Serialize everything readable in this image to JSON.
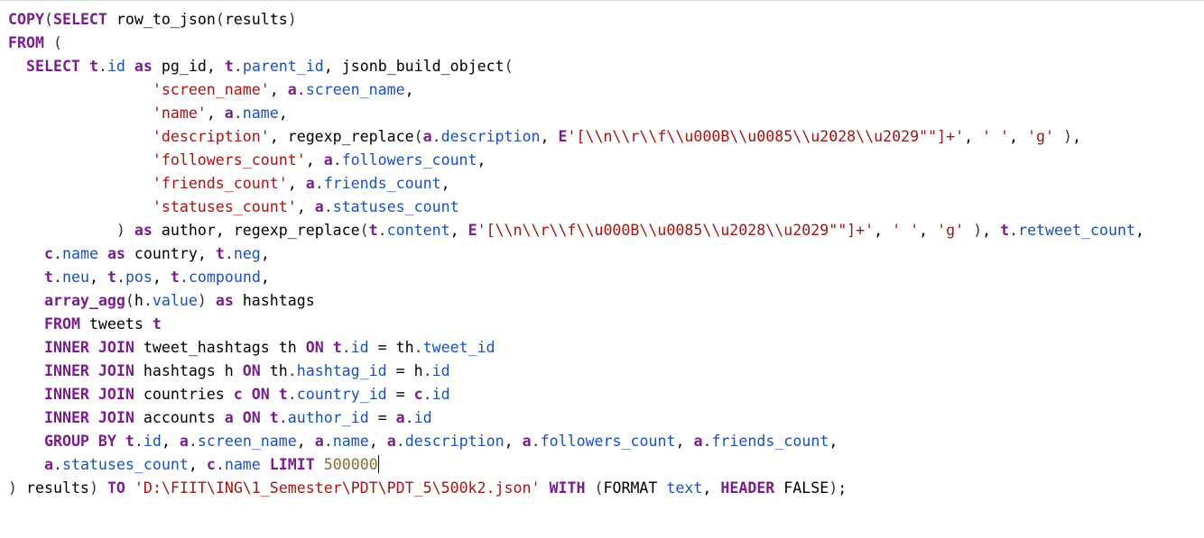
{
  "editor": {
    "lines": [
      [
        [
          "keyword",
          "COPY"
        ],
        [
          "punct",
          "("
        ],
        [
          "keyword",
          "SELECT"
        ],
        [
          "plain",
          " row_to_json"
        ],
        [
          "punct",
          "("
        ],
        [
          "plain",
          "results"
        ],
        [
          "punct",
          ")"
        ]
      ],
      [
        [
          "keyword",
          "FROM"
        ],
        [
          "plain",
          " "
        ],
        [
          "punct",
          "("
        ]
      ],
      [
        [
          "plain",
          "  "
        ],
        [
          "keyword",
          "SELECT"
        ],
        [
          "plain",
          " "
        ],
        [
          "alias",
          "t"
        ],
        [
          "punct",
          "."
        ],
        [
          "member",
          "id"
        ],
        [
          "plain",
          " "
        ],
        [
          "keyword",
          "as"
        ],
        [
          "plain",
          " pg_id, "
        ],
        [
          "alias",
          "t"
        ],
        [
          "punct",
          "."
        ],
        [
          "member",
          "parent_id"
        ],
        [
          "plain",
          ", jsonb_build_object"
        ],
        [
          "punct",
          "("
        ]
      ],
      [
        [
          "plain",
          "                "
        ],
        [
          "string",
          "'screen_name'"
        ],
        [
          "plain",
          ", "
        ],
        [
          "alias",
          "a"
        ],
        [
          "punct",
          "."
        ],
        [
          "member",
          "screen_name"
        ],
        [
          "plain",
          ","
        ]
      ],
      [
        [
          "plain",
          "                "
        ],
        [
          "string",
          "'name'"
        ],
        [
          "plain",
          ", "
        ],
        [
          "alias",
          "a"
        ],
        [
          "punct",
          "."
        ],
        [
          "member",
          "name"
        ],
        [
          "plain",
          ","
        ]
      ],
      [
        [
          "plain",
          "                "
        ],
        [
          "string",
          "'description'"
        ],
        [
          "plain",
          ", regexp_replace"
        ],
        [
          "punct",
          "("
        ],
        [
          "alias",
          "a"
        ],
        [
          "punct",
          "."
        ],
        [
          "member",
          "description"
        ],
        [
          "plain",
          ", "
        ],
        [
          "keyword",
          "E"
        ],
        [
          "string",
          "'[\\\\n\\\\r\\\\f\\\\u000B\\\\u0085\\\\u2028\\\\u2029\"\"]+'"
        ],
        [
          "plain",
          ", "
        ],
        [
          "string",
          "' '"
        ],
        [
          "plain",
          ", "
        ],
        [
          "string",
          "'g'"
        ],
        [
          "plain",
          " "
        ],
        [
          "punct",
          ")"
        ],
        [
          "plain",
          ","
        ]
      ],
      [
        [
          "plain",
          "                "
        ],
        [
          "string",
          "'followers_count'"
        ],
        [
          "plain",
          ", "
        ],
        [
          "alias",
          "a"
        ],
        [
          "punct",
          "."
        ],
        [
          "member",
          "followers_count"
        ],
        [
          "plain",
          ","
        ]
      ],
      [
        [
          "plain",
          "                "
        ],
        [
          "string",
          "'friends_count'"
        ],
        [
          "plain",
          ", "
        ],
        [
          "alias",
          "a"
        ],
        [
          "punct",
          "."
        ],
        [
          "member",
          "friends_count"
        ],
        [
          "plain",
          ","
        ]
      ],
      [
        [
          "plain",
          "                "
        ],
        [
          "string",
          "'statuses_count'"
        ],
        [
          "plain",
          ", "
        ],
        [
          "alias",
          "a"
        ],
        [
          "punct",
          "."
        ],
        [
          "member",
          "statuses_count"
        ]
      ],
      [
        [
          "plain",
          "            "
        ],
        [
          "punct",
          ")"
        ],
        [
          "plain",
          " "
        ],
        [
          "keyword",
          "as"
        ],
        [
          "plain",
          " author, regexp_replace"
        ],
        [
          "punct",
          "("
        ],
        [
          "alias",
          "t"
        ],
        [
          "punct",
          "."
        ],
        [
          "member",
          "content"
        ],
        [
          "plain",
          ", "
        ],
        [
          "keyword",
          "E"
        ],
        [
          "string",
          "'[\\\\n\\\\r\\\\f\\\\u000B\\\\u0085\\\\u2028\\\\u2029\"\"]+'"
        ],
        [
          "plain",
          ", "
        ],
        [
          "string",
          "' '"
        ],
        [
          "plain",
          ", "
        ],
        [
          "string",
          "'g'"
        ],
        [
          "plain",
          " "
        ],
        [
          "punct",
          ")"
        ],
        [
          "plain",
          ", "
        ],
        [
          "alias",
          "t"
        ],
        [
          "punct",
          "."
        ],
        [
          "member",
          "retweet_count"
        ],
        [
          "plain",
          ","
        ]
      ],
      [
        [
          "plain",
          "    "
        ],
        [
          "alias",
          "c"
        ],
        [
          "punct",
          "."
        ],
        [
          "member",
          "name"
        ],
        [
          "plain",
          " "
        ],
        [
          "keyword",
          "as"
        ],
        [
          "plain",
          " country, "
        ],
        [
          "alias",
          "t"
        ],
        [
          "punct",
          "."
        ],
        [
          "member",
          "neg"
        ],
        [
          "plain",
          ","
        ]
      ],
      [
        [
          "plain",
          "    "
        ],
        [
          "alias",
          "t"
        ],
        [
          "punct",
          "."
        ],
        [
          "member",
          "neu"
        ],
        [
          "plain",
          ", "
        ],
        [
          "alias",
          "t"
        ],
        [
          "punct",
          "."
        ],
        [
          "member",
          "pos"
        ],
        [
          "plain",
          ", "
        ],
        [
          "alias",
          "t"
        ],
        [
          "punct",
          "."
        ],
        [
          "member",
          "compound"
        ],
        [
          "plain",
          ","
        ]
      ],
      [
        [
          "plain",
          "    "
        ],
        [
          "keyword",
          "array_agg"
        ],
        [
          "punct",
          "("
        ],
        [
          "plain",
          "h"
        ],
        [
          "punct",
          "."
        ],
        [
          "member",
          "value"
        ],
        [
          "punct",
          ")"
        ],
        [
          "plain",
          " "
        ],
        [
          "keyword",
          "as"
        ],
        [
          "plain",
          " hashtags"
        ]
      ],
      [
        [
          "plain",
          "    "
        ],
        [
          "keyword",
          "FROM"
        ],
        [
          "plain",
          " tweets "
        ],
        [
          "alias",
          "t"
        ]
      ],
      [
        [
          "plain",
          "    "
        ],
        [
          "keyword",
          "INNER JOIN"
        ],
        [
          "plain",
          " tweet_hashtags th "
        ],
        [
          "keyword",
          "ON"
        ],
        [
          "plain",
          " "
        ],
        [
          "alias",
          "t"
        ],
        [
          "punct",
          "."
        ],
        [
          "member",
          "id"
        ],
        [
          "plain",
          " = th"
        ],
        [
          "punct",
          "."
        ],
        [
          "member",
          "tweet_id"
        ]
      ],
      [
        [
          "plain",
          "    "
        ],
        [
          "keyword",
          "INNER JOIN"
        ],
        [
          "plain",
          " hashtags h "
        ],
        [
          "keyword",
          "ON"
        ],
        [
          "plain",
          " th"
        ],
        [
          "punct",
          "."
        ],
        [
          "member",
          "hashtag_id"
        ],
        [
          "plain",
          " = h"
        ],
        [
          "punct",
          "."
        ],
        [
          "member",
          "id"
        ]
      ],
      [
        [
          "plain",
          "    "
        ],
        [
          "keyword",
          "INNER JOIN"
        ],
        [
          "plain",
          " countries "
        ],
        [
          "alias",
          "c"
        ],
        [
          "plain",
          " "
        ],
        [
          "keyword",
          "ON"
        ],
        [
          "plain",
          " "
        ],
        [
          "alias",
          "t"
        ],
        [
          "punct",
          "."
        ],
        [
          "member",
          "country_id"
        ],
        [
          "plain",
          " = "
        ],
        [
          "alias",
          "c"
        ],
        [
          "punct",
          "."
        ],
        [
          "member",
          "id"
        ]
      ],
      [
        [
          "plain",
          "    "
        ],
        [
          "keyword",
          "INNER JOIN"
        ],
        [
          "plain",
          " accounts "
        ],
        [
          "alias",
          "a"
        ],
        [
          "plain",
          " "
        ],
        [
          "keyword",
          "ON"
        ],
        [
          "plain",
          " "
        ],
        [
          "alias",
          "t"
        ],
        [
          "punct",
          "."
        ],
        [
          "member",
          "author_id"
        ],
        [
          "plain",
          " = "
        ],
        [
          "alias",
          "a"
        ],
        [
          "punct",
          "."
        ],
        [
          "member",
          "id"
        ]
      ],
      [
        [
          "plain",
          "    "
        ],
        [
          "keyword",
          "GROUP BY"
        ],
        [
          "plain",
          " "
        ],
        [
          "alias",
          "t"
        ],
        [
          "punct",
          "."
        ],
        [
          "member",
          "id"
        ],
        [
          "plain",
          ", "
        ],
        [
          "alias",
          "a"
        ],
        [
          "punct",
          "."
        ],
        [
          "member",
          "screen_name"
        ],
        [
          "plain",
          ", "
        ],
        [
          "alias",
          "a"
        ],
        [
          "punct",
          "."
        ],
        [
          "member",
          "name"
        ],
        [
          "plain",
          ", "
        ],
        [
          "alias",
          "a"
        ],
        [
          "punct",
          "."
        ],
        [
          "member",
          "description"
        ],
        [
          "plain",
          ", "
        ],
        [
          "alias",
          "a"
        ],
        [
          "punct",
          "."
        ],
        [
          "member",
          "followers_count"
        ],
        [
          "plain",
          ", "
        ],
        [
          "alias",
          "a"
        ],
        [
          "punct",
          "."
        ],
        [
          "member",
          "friends_count"
        ],
        [
          "plain",
          ","
        ]
      ],
      [
        [
          "plain",
          "    "
        ],
        [
          "alias",
          "a"
        ],
        [
          "punct",
          "."
        ],
        [
          "member",
          "statuses_count"
        ],
        [
          "plain",
          ", "
        ],
        [
          "alias",
          "c"
        ],
        [
          "punct",
          "."
        ],
        [
          "member",
          "name"
        ],
        [
          "plain",
          " "
        ],
        [
          "keyword",
          "LIMIT"
        ],
        [
          "plain",
          " "
        ],
        [
          "number",
          "500000"
        ],
        [
          "cursor",
          ""
        ]
      ],
      [
        [
          "punct",
          ")"
        ],
        [
          "plain",
          " results"
        ],
        [
          "punct",
          ")"
        ],
        [
          "plain",
          " "
        ],
        [
          "keyword",
          "TO"
        ],
        [
          "plain",
          " "
        ],
        [
          "string",
          "'D:\\FIIT\\ING\\1_Semester\\PDT\\PDT_5\\500k2.json'"
        ],
        [
          "plain",
          " "
        ],
        [
          "keyword",
          "WITH"
        ],
        [
          "plain",
          " "
        ],
        [
          "punct",
          "("
        ],
        [
          "plain",
          "FORMAT "
        ],
        [
          "type",
          "text"
        ],
        [
          "plain",
          ", "
        ],
        [
          "keyword",
          "HEADER"
        ],
        [
          "plain",
          " FALSE"
        ],
        [
          "punct",
          ")"
        ],
        [
          "plain",
          ";"
        ]
      ]
    ]
  }
}
